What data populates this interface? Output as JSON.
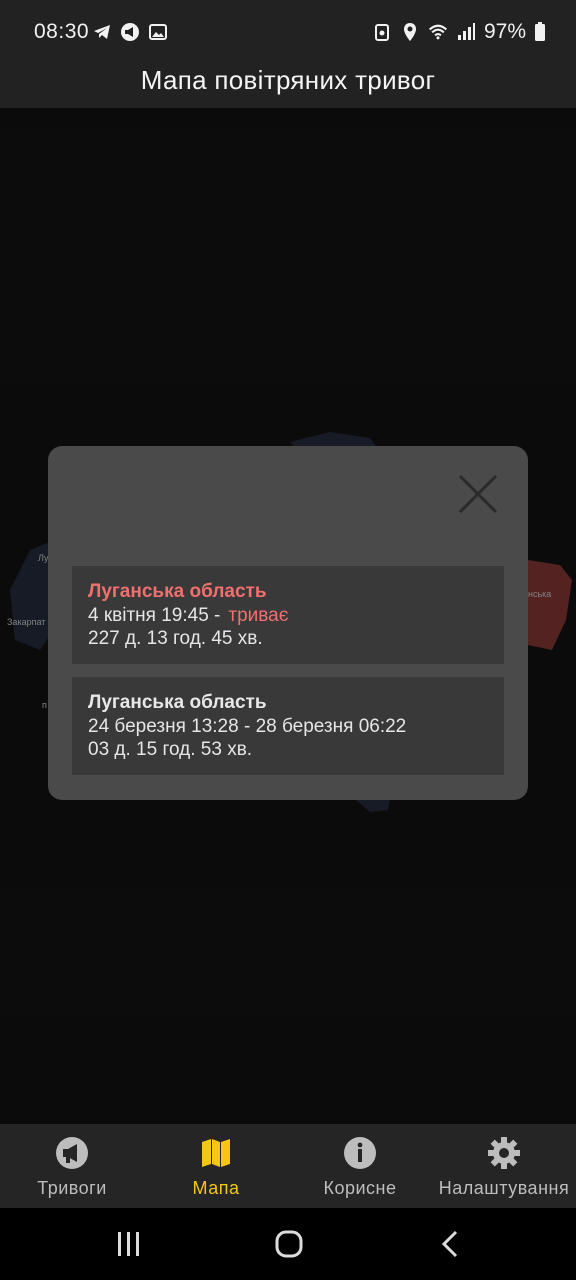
{
  "status_bar": {
    "time": "08:30",
    "battery": "97%",
    "left_icons": [
      "telegram-icon",
      "broadcast-icon",
      "image-icon"
    ],
    "right_icons": [
      "cast-icon",
      "location-icon",
      "wifi-icon",
      "signal-icon",
      "battery-icon"
    ]
  },
  "header": {
    "title": "Мапа повітряних тривог"
  },
  "map": {
    "labels": [
      "Закарпат",
      "Лу",
      "нська",
      "п"
    ],
    "alert_color": "#6e2b2b"
  },
  "dialog": {
    "close_icon": "close-icon",
    "alerts": [
      {
        "region": "Луганська область",
        "period_start": "4 квітня 19:45 -",
        "status": "триває",
        "duration": "227 д. 13 год. 45 хв."
      },
      {
        "region": "Луганська область",
        "period": "24 березня 13:28 - 28 березня 06:22",
        "duration": "03 д. 15 год. 53 хв."
      }
    ]
  },
  "bottom_nav": {
    "items": [
      {
        "label": "Тривоги",
        "icon": "megaphone-icon"
      },
      {
        "label": "Мапа",
        "icon": "map-icon",
        "selected": true
      },
      {
        "label": "Корисне",
        "icon": "info-icon"
      },
      {
        "label": "Налаштування",
        "icon": "gear-icon"
      }
    ],
    "accent_color": "#f5c518"
  },
  "system_nav": {
    "buttons": [
      "recents-icon",
      "home-icon",
      "back-icon"
    ]
  }
}
